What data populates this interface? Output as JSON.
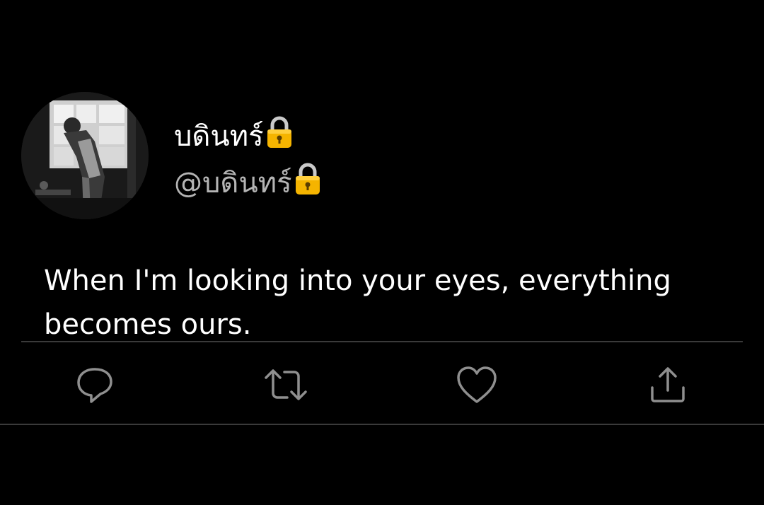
{
  "user": {
    "display_name": "บดินทร์",
    "handle": "@บดินทร์",
    "verified_icon": "lock-icon"
  },
  "tweet": {
    "text": "When I'm looking into your eyes, everything becomes ours."
  },
  "actions": [
    {
      "name": "reply",
      "icon": "reply-icon"
    },
    {
      "name": "retweet",
      "icon": "retweet-icon"
    },
    {
      "name": "like",
      "icon": "heart-icon"
    },
    {
      "name": "share",
      "icon": "share-icon"
    }
  ],
  "colors": {
    "background": "#000000",
    "text_primary": "#ffffff",
    "text_secondary": "#b4b4b4",
    "icon": "#8f8f8f",
    "divider": "#3a3a3a",
    "lock": "#f5b400"
  }
}
